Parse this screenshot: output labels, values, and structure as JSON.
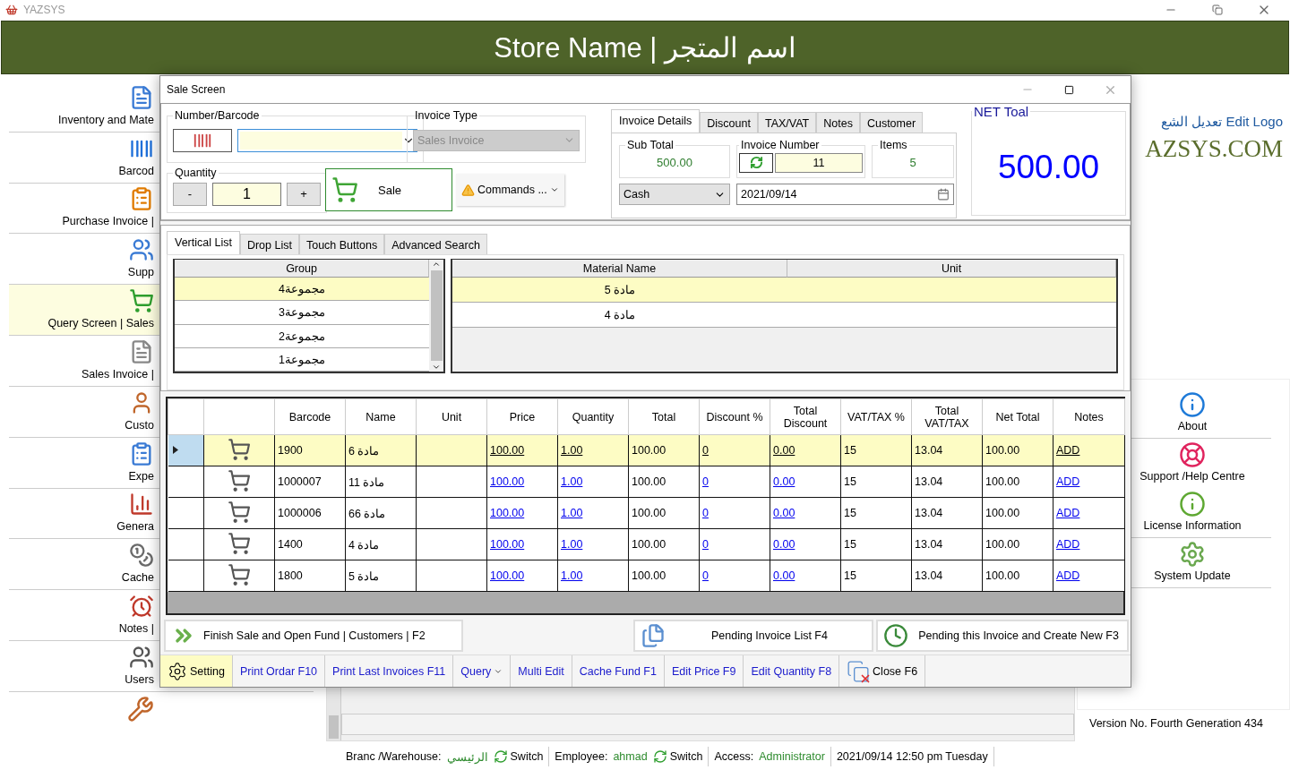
{
  "app": {
    "title": "YAZSYS"
  },
  "header": {
    "store_name": "Store Name | اسم المتجر"
  },
  "sidebar": {
    "items": [
      {
        "label": "Inventory and Mate",
        "selected": false
      },
      {
        "label": "Barcod",
        "selected": false
      },
      {
        "label": "Purchase Invoice |",
        "selected": false
      },
      {
        "label": "Supp",
        "selected": false
      },
      {
        "label": "Query Screen | Sales",
        "selected": true
      },
      {
        "label": "Sales Invoice |",
        "selected": false
      },
      {
        "label": "Custo",
        "selected": false
      },
      {
        "label": "Expe",
        "selected": false
      },
      {
        "label": "Genera",
        "selected": false
      },
      {
        "label": "Cache",
        "selected": false
      },
      {
        "label": "Notes |",
        "selected": false
      },
      {
        "label": "Users",
        "selected": false
      }
    ]
  },
  "logo": {
    "edit_link": "تعديل الشع Edit Logo",
    "text": "AZSYS.COM"
  },
  "right_panel": {
    "items": [
      {
        "label": "About"
      },
      {
        "label": "Support /Help Centre"
      },
      {
        "label": "License Information"
      },
      {
        "label": "System Update"
      }
    ],
    "version": "Version No.  Fourth Generation 434"
  },
  "status_bar": {
    "branch_label": "Branc /Warehouse:",
    "branch": "الرئيسي",
    "branch_switch": "Switch",
    "employee_label": "Employee:",
    "employee": "ahmad",
    "employee_switch": "Switch",
    "access_label": "Access:",
    "access": "Administrator",
    "datetime": "2021/09/14 12:50 pm Tuesday"
  },
  "dialog": {
    "title": "Sale Screen",
    "barcode_group": {
      "label": "Number/Barcode"
    },
    "invoice_type": {
      "label": "Invoice Type",
      "value": "Sales Invoice",
      "disabled": true
    },
    "quantity": {
      "label": "Quantity",
      "minus": "-",
      "value": "1",
      "plus": "+"
    },
    "sale_button": "Sale",
    "commands_button": "Commands ...",
    "detail_tabs": [
      {
        "label": "Invoice Details",
        "selected": true
      },
      {
        "label": "Discount",
        "selected": false
      },
      {
        "label": "TAX/VAT",
        "selected": false
      },
      {
        "label": "Notes",
        "selected": false
      },
      {
        "label": "Customer",
        "selected": false
      }
    ],
    "sub_total": {
      "label": "Sub Total",
      "value": "500.00"
    },
    "invoice_number": {
      "label": "Invoice Number",
      "value": "11"
    },
    "items_count": {
      "label": "Items",
      "value": "5"
    },
    "payment": {
      "value": "Cash"
    },
    "date": {
      "value": "2021/09/14"
    },
    "net_total": {
      "label": "NET Toal",
      "value": "500.00"
    },
    "list_tabs": [
      {
        "label": "Vertical List",
        "selected": true
      },
      {
        "label": "Drop List",
        "selected": false
      },
      {
        "label": "Touch Buttons",
        "selected": false
      },
      {
        "label": "Advanced Search",
        "selected": false
      }
    ],
    "groups": {
      "column": "Group",
      "rows": [
        {
          "name": "مجموعة4",
          "selected": true
        },
        {
          "name": "مجموعة3",
          "selected": false
        },
        {
          "name": "مجموعة2",
          "selected": false
        },
        {
          "name": "مجموعة1",
          "selected": false
        }
      ]
    },
    "materials": {
      "columns": [
        "Material Name",
        "Unit"
      ],
      "rows": [
        {
          "name": "مادة 5",
          "selected": true
        },
        {
          "name": "مادة 4",
          "selected": false
        }
      ]
    },
    "table": {
      "columns": [
        "Barcode",
        "Name",
        "Unit",
        "Price",
        "Quantity",
        "Total",
        "Discount %",
        "Total Discount",
        "VAT/TAX %",
        "Total VAT/TAX",
        "Net Total",
        "Notes"
      ],
      "rows": [
        {
          "selected": true,
          "barcode": "1900",
          "name": "مادة 6",
          "price": "100.00",
          "quantity": "1.00",
          "total": "100.00",
          "discount_pct": "0",
          "total_discount": "0.00",
          "vat_pct": "15",
          "total_vat": "13.04",
          "net_total": "100.00",
          "notes": "ADD"
        },
        {
          "selected": false,
          "barcode": "1000007",
          "name": "مادة 11",
          "price": "100.00",
          "quantity": "1.00",
          "total": "100.00",
          "discount_pct": "0",
          "total_discount": "0.00",
          "vat_pct": "15",
          "total_vat": "13.04",
          "net_total": "100.00",
          "notes": "ADD"
        },
        {
          "selected": false,
          "barcode": "1000006",
          "name": "مادة 66",
          "price": "100.00",
          "quantity": "1.00",
          "total": "100.00",
          "discount_pct": "0",
          "total_discount": "0.00",
          "vat_pct": "15",
          "total_vat": "13.04",
          "net_total": "100.00",
          "notes": "ADD"
        },
        {
          "selected": false,
          "barcode": "1400",
          "name": "مادة 4",
          "price": "100.00",
          "quantity": "1.00",
          "total": "100.00",
          "discount_pct": "0",
          "total_discount": "0.00",
          "vat_pct": "15",
          "total_vat": "13.04",
          "net_total": "100.00",
          "notes": "ADD"
        },
        {
          "selected": false,
          "barcode": "1800",
          "name": "مادة 5",
          "price": "100.00",
          "quantity": "1.00",
          "total": "100.00",
          "discount_pct": "0",
          "total_discount": "0.00",
          "vat_pct": "15",
          "total_vat": "13.04",
          "net_total": "100.00",
          "notes": "ADD"
        }
      ]
    },
    "finish_button": "Finish Sale and Open Fund | Customers | F2",
    "pending_list_button": "Pending  Invoice List F4",
    "pending_new_button": "Pending this Invoice and Create New F3",
    "toolbar": [
      {
        "kind": "setting",
        "label": "Setting",
        "selected": true
      },
      {
        "kind": "link",
        "label": "Print Ordar F10"
      },
      {
        "kind": "link",
        "label": "Print Last Invoices F11"
      },
      {
        "kind": "menu",
        "label": "Query"
      },
      {
        "kind": "link",
        "label": "Multi Edit"
      },
      {
        "kind": "link",
        "label": "Cache Fund F1"
      },
      {
        "kind": "link",
        "label": "Edit Price F9"
      },
      {
        "kind": "link",
        "label": "Edit Quantity F8"
      },
      {
        "kind": "close",
        "label": "Close F6"
      }
    ]
  }
}
